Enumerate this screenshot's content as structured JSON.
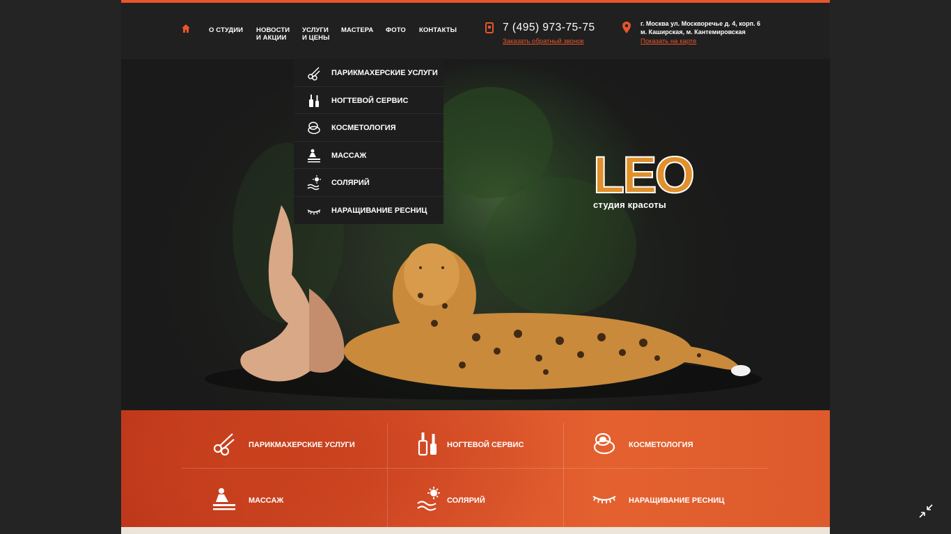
{
  "header": {
    "nav": [
      {
        "label_line1": "О СТУДИИ",
        "label_line2": ""
      },
      {
        "label_line1": "НОВОСТИ",
        "label_line2": "И АКЦИИ"
      },
      {
        "label_line1": "УСЛУГИ",
        "label_line2": "И ЦЕНЫ"
      },
      {
        "label_line1": "МАСТЕРА",
        "label_line2": ""
      },
      {
        "label_line1": "ФОТО",
        "label_line2": ""
      },
      {
        "label_line1": "КОНТАКТЫ",
        "label_line2": ""
      }
    ],
    "phone": "7 (495) 973-75-75",
    "callback_link": "Заказать обратный звонок",
    "address_line1": "г. Москва ул. Москворечье д. 4, корп. 6",
    "address_line2": "м. Каширская, м. Кантемировская",
    "map_link": "Показать на карте"
  },
  "dropdown": {
    "items": [
      {
        "label": "ПАРИКМАХЕРСКИЕ УСЛУГИ",
        "icon": "scissors-icon"
      },
      {
        "label": "НОГТЕВОЙ СЕРВИС",
        "icon": "nail-polish-icon"
      },
      {
        "label": "КОСМЕТОЛОГИЯ",
        "icon": "compact-mirror-icon"
      },
      {
        "label": "МАССАЖ",
        "icon": "massage-icon"
      },
      {
        "label": "СОЛЯРИЙ",
        "icon": "sun-tanning-icon"
      },
      {
        "label": "НАРАЩИВАНИЕ РЕСНИЦ",
        "icon": "eyelash-icon"
      }
    ]
  },
  "logo": {
    "word": "LEO",
    "subtitle": "студия красоты"
  },
  "services": {
    "items": [
      {
        "label": "ПАРИКМАХЕРСКИЕ УСЛУГИ",
        "icon": "scissors-icon"
      },
      {
        "label": "НОГТЕВОЙ СЕРВИС",
        "icon": "nail-polish-icon"
      },
      {
        "label": "КОСМЕТОЛОГИЯ",
        "icon": "compact-mirror-icon"
      },
      {
        "label": "МАССАЖ",
        "icon": "massage-icon"
      },
      {
        "label": "СОЛЯРИЙ",
        "icon": "sun-tanning-icon"
      },
      {
        "label": "НАРАЩИВАНИЕ РЕСНИЦ",
        "icon": "eyelash-icon"
      }
    ]
  },
  "colors": {
    "accent": "#e8552a",
    "header_bg": "#202020",
    "services_bg": "#d8512b"
  }
}
